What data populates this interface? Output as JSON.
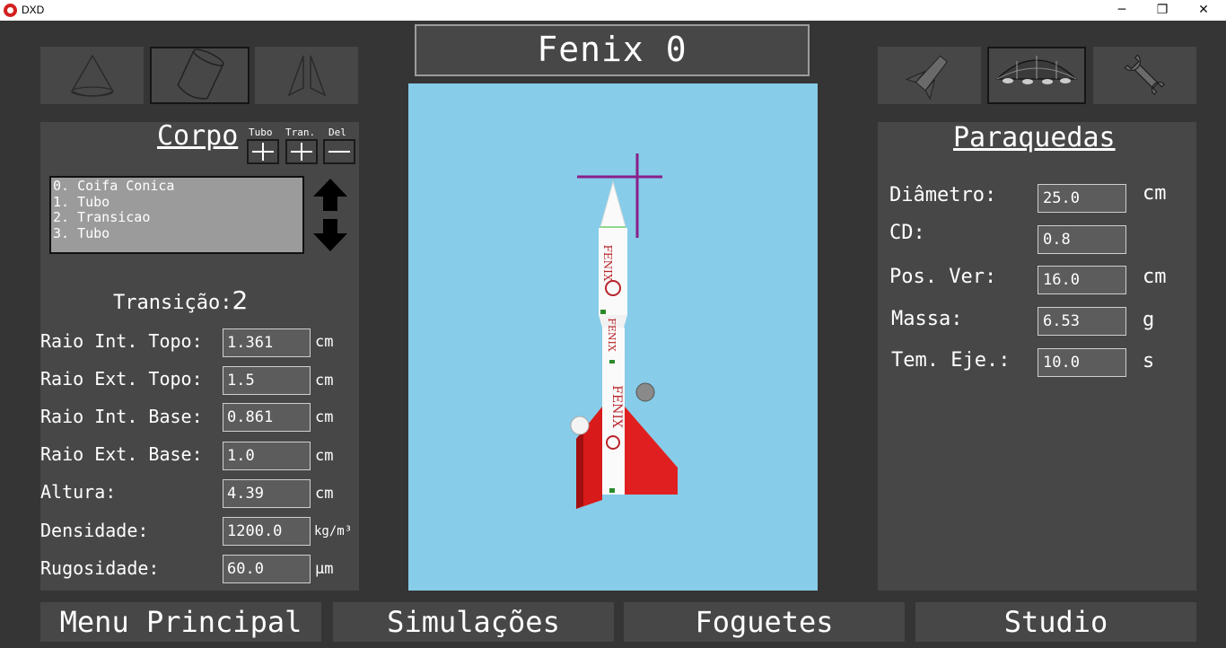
{
  "window": {
    "title": "DXD",
    "minimize_glyph": "─",
    "restore_glyph": "❐",
    "close_glyph": "✕"
  },
  "rocket_name": "Fenix 0",
  "left_tools": [
    {
      "icon": "cone-icon",
      "selected": false
    },
    {
      "icon": "cylinder-icon",
      "selected": true
    },
    {
      "icon": "fins-icon",
      "selected": false
    }
  ],
  "right_tools": [
    {
      "icon": "rocket-part-icon",
      "selected": false
    },
    {
      "icon": "parachute-icon",
      "selected": true
    },
    {
      "icon": "wrench-icon",
      "selected": false
    }
  ],
  "body_panel": {
    "heading": "Corpo",
    "add_tube_label": "Tubo",
    "add_transition_label": "Tran.",
    "delete_label": "Del",
    "components": [
      "0. Coifa Conica",
      "1. Tubo",
      "2. Transicao",
      "3. Tubo"
    ],
    "selected_label": "Transição:",
    "selected_index": "2",
    "fields": [
      {
        "label": "Raio Int. Topo:",
        "value": "1.361",
        "unit": "cm"
      },
      {
        "label": "Raio Ext. Topo:",
        "value": "1.5",
        "unit": "cm"
      },
      {
        "label": "Raio Int. Base:",
        "value": "0.861",
        "unit": "cm"
      },
      {
        "label": "Raio Ext. Base:",
        "value": "1.0",
        "unit": "cm"
      },
      {
        "label": "Altura:",
        "value": "4.39",
        "unit": "cm"
      },
      {
        "label": "Densidade:",
        "value": "1200.0",
        "unit": "kg/m³"
      },
      {
        "label": "Rugosidade:",
        "value": "60.0",
        "unit": "µm"
      }
    ]
  },
  "parachute_panel": {
    "heading": "Paraquedas",
    "fields": [
      {
        "label": "Diâmetro:",
        "value": "25.0",
        "unit": "cm"
      },
      {
        "label": "CD:",
        "value": "0.8",
        "unit": ""
      },
      {
        "label": "Pos. Ver:",
        "value": "16.0",
        "unit": "cm"
      },
      {
        "label": "Massa:",
        "value": "6.53",
        "unit": "g"
      },
      {
        "label": "Tem. Eje.:",
        "value": "10.0",
        "unit": "s"
      }
    ]
  },
  "rocket_decals": [
    "FENIX",
    "FENIX",
    "FENIX"
  ],
  "bottom_nav": [
    "Menu Principal",
    "Simulações",
    "Foguetes",
    "Studio"
  ],
  "colors": {
    "background": "#353535",
    "panel": "#474747",
    "viewport_sky": "#87cce8",
    "fin_red": "#e01c1c",
    "axis_purple": "#8a1f8a"
  }
}
